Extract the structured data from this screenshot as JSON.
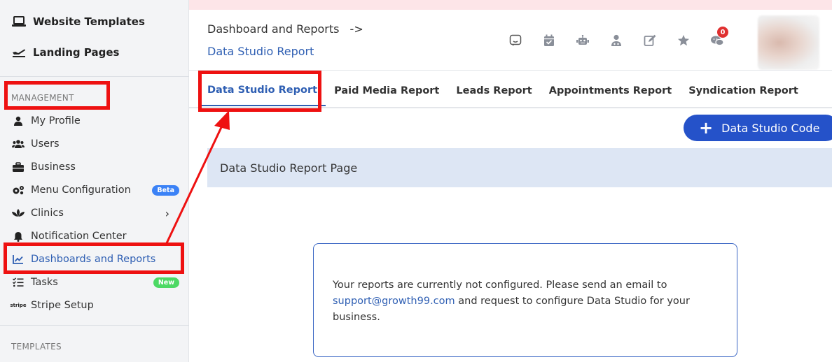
{
  "sidebar": {
    "website_templates": "Website Templates",
    "landing_pages": "Landing Pages",
    "management_label": "MANAGEMENT",
    "templates_label": "TEMPLATES",
    "items": [
      {
        "label": "My Profile",
        "icon": "user-icon"
      },
      {
        "label": "Users",
        "icon": "users-icon"
      },
      {
        "label": "Business",
        "icon": "briefcase-icon"
      },
      {
        "label": "Menu Configuration",
        "icon": "cogs-icon",
        "badge": "Beta"
      },
      {
        "label": "Clinics",
        "icon": "lotus-icon"
      },
      {
        "label": "Notification Center",
        "icon": "bell-icon"
      },
      {
        "label": "Dashboards and Reports",
        "icon": "chart-line-icon",
        "active": true
      },
      {
        "label": "Tasks",
        "icon": "tasks-icon",
        "badge": "New"
      },
      {
        "label": "Stripe Setup",
        "icon": "stripe-icon",
        "icon_text": "stripe"
      }
    ]
  },
  "breadcrumb": {
    "parent": "Dashboard and Reports",
    "arrow": "->",
    "current": "Data Studio Report"
  },
  "toolbar": {
    "icons": [
      "chat-icon",
      "calendar-icon",
      "robot-icon",
      "user-doctor-icon",
      "edit-icon",
      "star-icon",
      "messages-icon"
    ],
    "notification_count": "0"
  },
  "tabs": [
    "Data Studio Report",
    "Paid Media Report",
    "Leads Report",
    "Appointments Report",
    "Syndication Report"
  ],
  "active_tab": "Data Studio Report",
  "code_button": {
    "plus": "+",
    "label": "Data Studio Code"
  },
  "panel": {
    "title": "Data Studio Report Page",
    "message_before": "Your reports are currently not configured. Please send an email to ",
    "email": "support@growth99.com",
    "message_after": " and request to configure Data Studio for your business."
  },
  "colors": {
    "accent": "#2f5fb3",
    "button": "#2552c9",
    "annotation": "#ee1111",
    "beta_badge": "#3b82f6",
    "new_badge": "#4cd964",
    "notification": "#e03030"
  }
}
